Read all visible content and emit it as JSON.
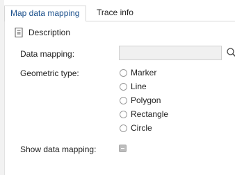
{
  "tabs": [
    {
      "label": "Map data mapping",
      "active": true
    },
    {
      "label": "Trace info",
      "active": false
    }
  ],
  "section": {
    "label": "Description",
    "icon": "document-icon"
  },
  "data_mapping": {
    "label": "Data mapping:",
    "value": "",
    "placeholder": "",
    "search_icon": "search-icon"
  },
  "geometric_type": {
    "label": "Geometric type:",
    "options": [
      {
        "label": "Marker",
        "selected": false
      },
      {
        "label": "Line",
        "selected": false
      },
      {
        "label": "Polygon",
        "selected": false
      },
      {
        "label": "Rectangle",
        "selected": false
      },
      {
        "label": "Circle",
        "selected": false
      }
    ]
  },
  "show_data_mapping": {
    "label": "Show data mapping:",
    "checked": false,
    "state": "indeterminate-disabled"
  },
  "colors": {
    "accent": "#1a4f8b",
    "border": "#d6d6d6",
    "input_bg": "#f0f0f0",
    "checkbox": "#bdbdbd"
  }
}
